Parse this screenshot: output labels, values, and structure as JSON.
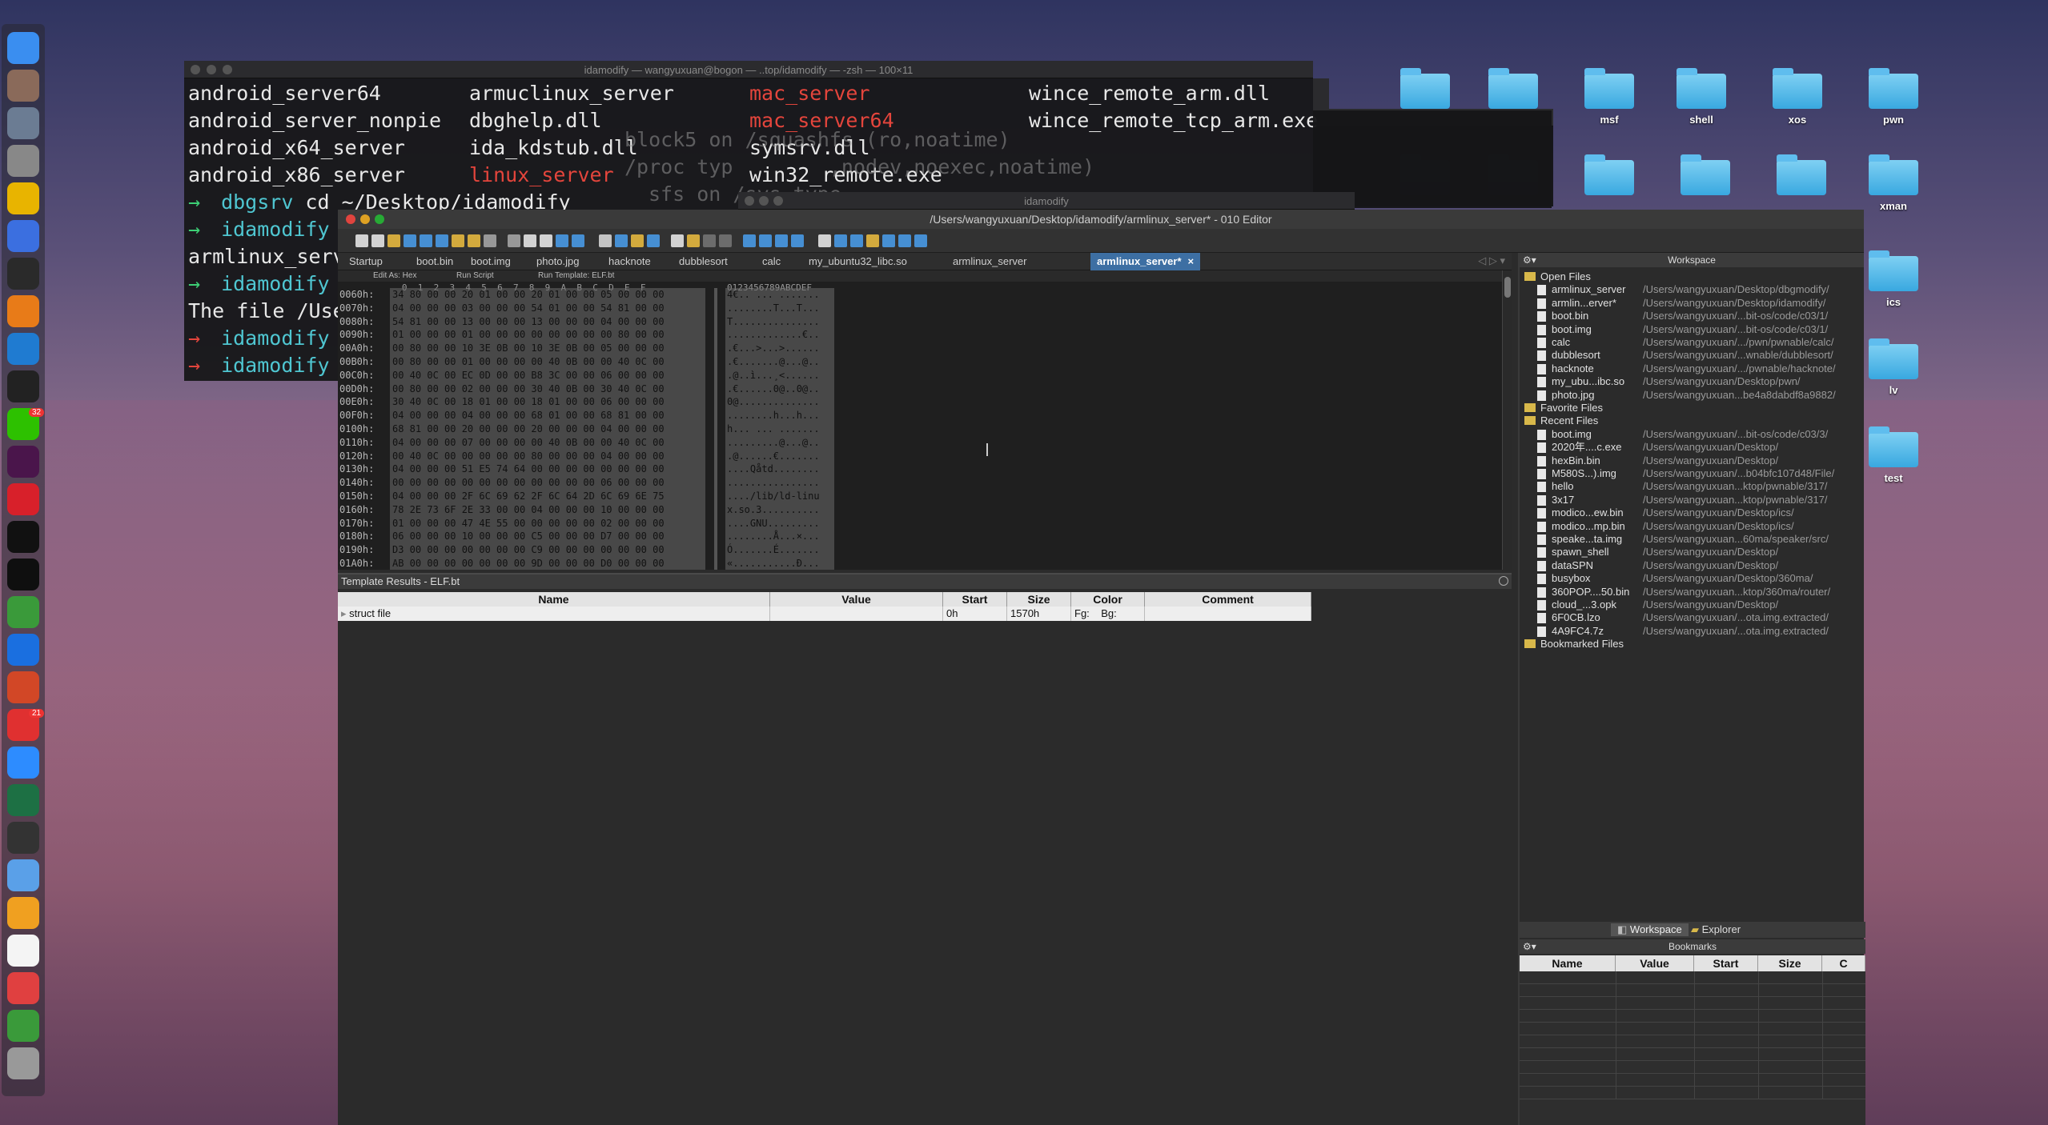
{
  "desktop": {
    "folders": [
      "msf",
      "shell",
      "xos",
      "pwn",
      "xman",
      "ics",
      "lv",
      "test"
    ]
  },
  "dock": {
    "apps": [
      "finder-icon",
      "avatar-icon",
      "launchpad-icon",
      "system-preferences-icon",
      "chrome-icon",
      "screens-icon",
      "typora-icon",
      "sublime-icon",
      "vscode-icon",
      "activity-monitor-icon",
      "wechat-icon",
      "slack-icon",
      "netease-music-icon",
      "terminal-icon",
      "iterm-icon",
      "vim-icon",
      "teamviewer-icon",
      "powerpoint-icon",
      "calendar-icon",
      "zoom-icon",
      "excel-icon",
      "claquette-icon",
      "preview-icon",
      "sketch-icon",
      "document-icon",
      "folder-icon",
      "finder-list-icon",
      "trash-icon"
    ],
    "badges": {
      "wechat": "32",
      "calendar": "21"
    }
  },
  "terminal1": {
    "title": "idamodify — wangyuxuan@bogon — ..top/idamodify — -zsh — 100×11",
    "lines": [
      {
        "cols": [
          "android_server64",
          "armuclinux_server",
          "mac_server",
          "wince_remote_arm.dll"
        ]
      },
      {
        "cols": [
          "android_server_nonpie",
          "dbghelp.dll",
          "mac_server64",
          "wince_remote_tcp_arm.exe"
        ]
      },
      {
        "cols": [
          "android_x64_server",
          "ida_kdstub.dll",
          "symsrv.dll",
          ""
        ]
      },
      {
        "cols": [
          "android_x86_server",
          "linux_server",
          "win32_remote.exe",
          ""
        ]
      }
    ],
    "prompts": [
      {
        "arrow": "→",
        "dir": "dbgsrv",
        "cmd": " cd ~/Desktop/idamodify"
      },
      {
        "arrow": "→",
        "dir": "idamodify",
        "cmd": ""
      },
      {
        "arrow": "",
        "dir": "",
        "cmd": "armlinux_serve"
      },
      {
        "arrow": "→",
        "dir": "idamodify",
        "cmd": " c"
      },
      {
        "arrow": "",
        "dir": "",
        "cmd": "The file /Use"
      },
      {
        "arrow": "→",
        "dir": "idamodify",
        "cmd": " c"
      },
      {
        "arrow": "→",
        "dir": "idamodify",
        "cmd": ""
      }
    ]
  },
  "terminal2": {
    "lines": [
      "block5 on /squashfs (ro,noatime)",
      "/proc typ        ,nodev,noexec,noatime)",
      "sfs on /sys type"
    ]
  },
  "terminal3": {
    "title": "idamodify"
  },
  "editor": {
    "title": "/Users/wangyuxuan/Desktop/idamodify/armlinux_server* - 010 Editor",
    "tabs": [
      "Startup",
      "boot.bin",
      "boot.img",
      "photo.jpg",
      "hacknote",
      "dubblesort",
      "calc",
      "my_ubuntu32_libc.so",
      "armlinux_server",
      "armlinux_server*"
    ],
    "active_tab_close": "×",
    "hex_toolbar": {
      "edit_as": "Edit As: Hex",
      "run_script": "Run Script",
      "run_template": "Run Template: ELF.bt"
    },
    "hex_header": "   0  1  2  3  4  5  6  7  8  9  A  B  C  D  E  F",
    "ascii_header": "0123456789ABCDEF",
    "hex_rows": [
      {
        "addr": "0060h:",
        "hex": "34 80 00 00 20 01 00 00 20 01 00 00 05 00 00 00",
        "ascii": "4€.. ... ......."
      },
      {
        "addr": "0070h:",
        "hex": "04 00 00 00 03 00 00 00 54 01 00 00 54 81 00 00",
        "ascii": "........T...T..."
      },
      {
        "addr": "0080h:",
        "hex": "54 81 00 00 13 00 00 00 13 00 00 00 04 00 00 00",
        "ascii": "T..............."
      },
      {
        "addr": "0090h:",
        "hex": "01 00 00 00 01 00 00 00 00 00 00 00 00 80 00 00",
        "ascii": ".............€.."
      },
      {
        "addr": "00A0h:",
        "hex": "00 80 00 00 10 3E 0B 00 10 3E 0B 00 05 00 00 00",
        "ascii": ".€...>...>......"
      },
      {
        "addr": "00B0h:",
        "hex": "00 80 00 00 01 00 00 00 00 40 0B 00 00 40 0C 00",
        "ascii": ".€.......@...@.."
      },
      {
        "addr": "00C0h:",
        "hex": "00 40 0C 00 EC 0D 00 00 B8 3C 00 00 06 00 00 00",
        "ascii": ".@..ì...¸<......"
      },
      {
        "addr": "00D0h:",
        "hex": "00 80 00 00 02 00 00 00 30 40 0B 00 30 40 0C 00",
        "ascii": ".€......0@..0@.."
      },
      {
        "addr": "00E0h:",
        "hex": "30 40 0C 00 18 01 00 00 18 01 00 00 06 00 00 00",
        "ascii": "0@.............."
      },
      {
        "addr": "00F0h:",
        "hex": "04 00 00 00 04 00 00 00 68 01 00 00 68 81 00 00",
        "ascii": "........h...h..."
      },
      {
        "addr": "0100h:",
        "hex": "68 81 00 00 20 00 00 00 20 00 00 00 04 00 00 00",
        "ascii": "h... ... ......."
      },
      {
        "addr": "0110h:",
        "hex": "04 00 00 00 07 00 00 00 00 40 0B 00 00 40 0C 00",
        "ascii": ".........@...@.."
      },
      {
        "addr": "0120h:",
        "hex": "00 40 0C 00 00 00 00 00 80 00 00 00 04 00 00 00",
        "ascii": ".@......€......."
      },
      {
        "addr": "0130h:",
        "hex": "04 00 00 00 51 E5 74 64 00 00 00 00 00 00 00 00",
        "ascii": "....Qåtd........"
      },
      {
        "addr": "0140h:",
        "hex": "00 00 00 00 00 00 00 00 00 00 00 00 06 00 00 00",
        "ascii": "................"
      },
      {
        "addr": "0150h:",
        "hex": "04 00 00 00 2F 6C 69 62 2F 6C 64 2D 6C 69 6E 75",
        "ascii": "..../lib/ld-linu"
      },
      {
        "addr": "0160h:",
        "hex": "78 2E 73 6F 2E 33 00 00 04 00 00 00 10 00 00 00",
        "ascii": "x.so.3.........."
      },
      {
        "addr": "0170h:",
        "hex": "01 00 00 00 47 4E 55 00 00 00 00 00 02 00 00 00",
        "ascii": "....GNU........."
      },
      {
        "addr": "0180h:",
        "hex": "06 00 00 00 10 00 00 00 C5 00 00 00 D7 00 00 00",
        "ascii": "........Å...×..."
      },
      {
        "addr": "0190h:",
        "hex": "D3 00 00 00 00 00 00 00 C9 00 00 00 00 00 00 00",
        "ascii": "Ó.......É......."
      },
      {
        "addr": "01A0h:",
        "hex": "AB 00 00 00 00 00 00 00 9D 00 00 00 D0 00 00 00",
        "ascii": "«...........Ð..."
      }
    ],
    "template": {
      "header": "Template Results - ELF.bt",
      "columns": [
        "Name",
        "Value",
        "Start",
        "Size",
        "Color",
        "Comment"
      ],
      "row": {
        "name": "struct file",
        "value": "",
        "start": "0h",
        "size": "1570h",
        "fg": "Fg:",
        "bg": "Bg:",
        "comment": ""
      }
    },
    "workspace": {
      "title": "Workspace",
      "open_files_label": "Open Files",
      "open_files": [
        {
          "n": "armlinux_server",
          "p": "/Users/wangyuxuan/Desktop/dbgmodify/"
        },
        {
          "n": "armlin...erver*",
          "p": "/Users/wangyuxuan/Desktop/idamodify/"
        },
        {
          "n": "boot.bin",
          "p": "/Users/wangyuxuan/...bit-os/code/c03/1/"
        },
        {
          "n": "boot.img",
          "p": "/Users/wangyuxuan/...bit-os/code/c03/1/"
        },
        {
          "n": "calc",
          "p": "/Users/wangyuxuan/.../pwn/pwnable/calc/"
        },
        {
          "n": "dubblesort",
          "p": "/Users/wangyuxuan/...wnable/dubblesort/"
        },
        {
          "n": "hacknote",
          "p": "/Users/wangyuxuan/.../pwnable/hacknote/"
        },
        {
          "n": "my_ubu...ibc.so",
          "p": "/Users/wangyuxuan/Desktop/pwn/"
        },
        {
          "n": "photo.jpg",
          "p": "/Users/wangyuxuan...be4a8dabdf8a9882/"
        }
      ],
      "favorite_label": "Favorite Files",
      "recent_label": "Recent Files",
      "recent_files": [
        {
          "n": "boot.img",
          "p": "/Users/wangyuxuan/...bit-os/code/c03/3/"
        },
        {
          "n": "2020年....c.exe",
          "p": "/Users/wangyuxuan/Desktop/"
        },
        {
          "n": "hexBin.bin",
          "p": "/Users/wangyuxuan/Desktop/"
        },
        {
          "n": "M580S...).img",
          "p": "/Users/wangyuxuan/...b04bfc107d48/File/"
        },
        {
          "n": "hello",
          "p": "/Users/wangyuxuan...ktop/pwnable/317/"
        },
        {
          "n": "3x17",
          "p": "/Users/wangyuxuan...ktop/pwnable/317/"
        },
        {
          "n": "modico...ew.bin",
          "p": "/Users/wangyuxuan/Desktop/ics/"
        },
        {
          "n": "modico...mp.bin",
          "p": "/Users/wangyuxuan/Desktop/ics/"
        },
        {
          "n": "speake...ta.img",
          "p": "/Users/wangyuxuan...60ma/speaker/src/"
        },
        {
          "n": "spawn_shell",
          "p": "/Users/wangyuxuan/Desktop/"
        },
        {
          "n": "dataSPN",
          "p": "/Users/wangyuxuan/Desktop/"
        },
        {
          "n": "busybox",
          "p": "/Users/wangyuxuan/Desktop/360ma/"
        },
        {
          "n": "360POP....50.bin",
          "p": "/Users/wangyuxuan...ktop/360ma/router/"
        },
        {
          "n": "cloud_...3.opk",
          "p": "/Users/wangyuxuan/Desktop/"
        },
        {
          "n": "6F0CB.lzo",
          "p": "/Users/wangyuxuan/...ota.img.extracted/"
        },
        {
          "n": "4A9FC4.7z",
          "p": "/Users/wangyuxuan/...ota.img.extracted/"
        }
      ],
      "bookmarked_label": "Bookmarked Files",
      "tab_workspace": "Workspace",
      "tab_explorer": "Explorer"
    },
    "bookmarks": {
      "title": "Bookmarks",
      "columns": [
        "Name",
        "Value",
        "Start",
        "Size",
        "C"
      ]
    }
  }
}
